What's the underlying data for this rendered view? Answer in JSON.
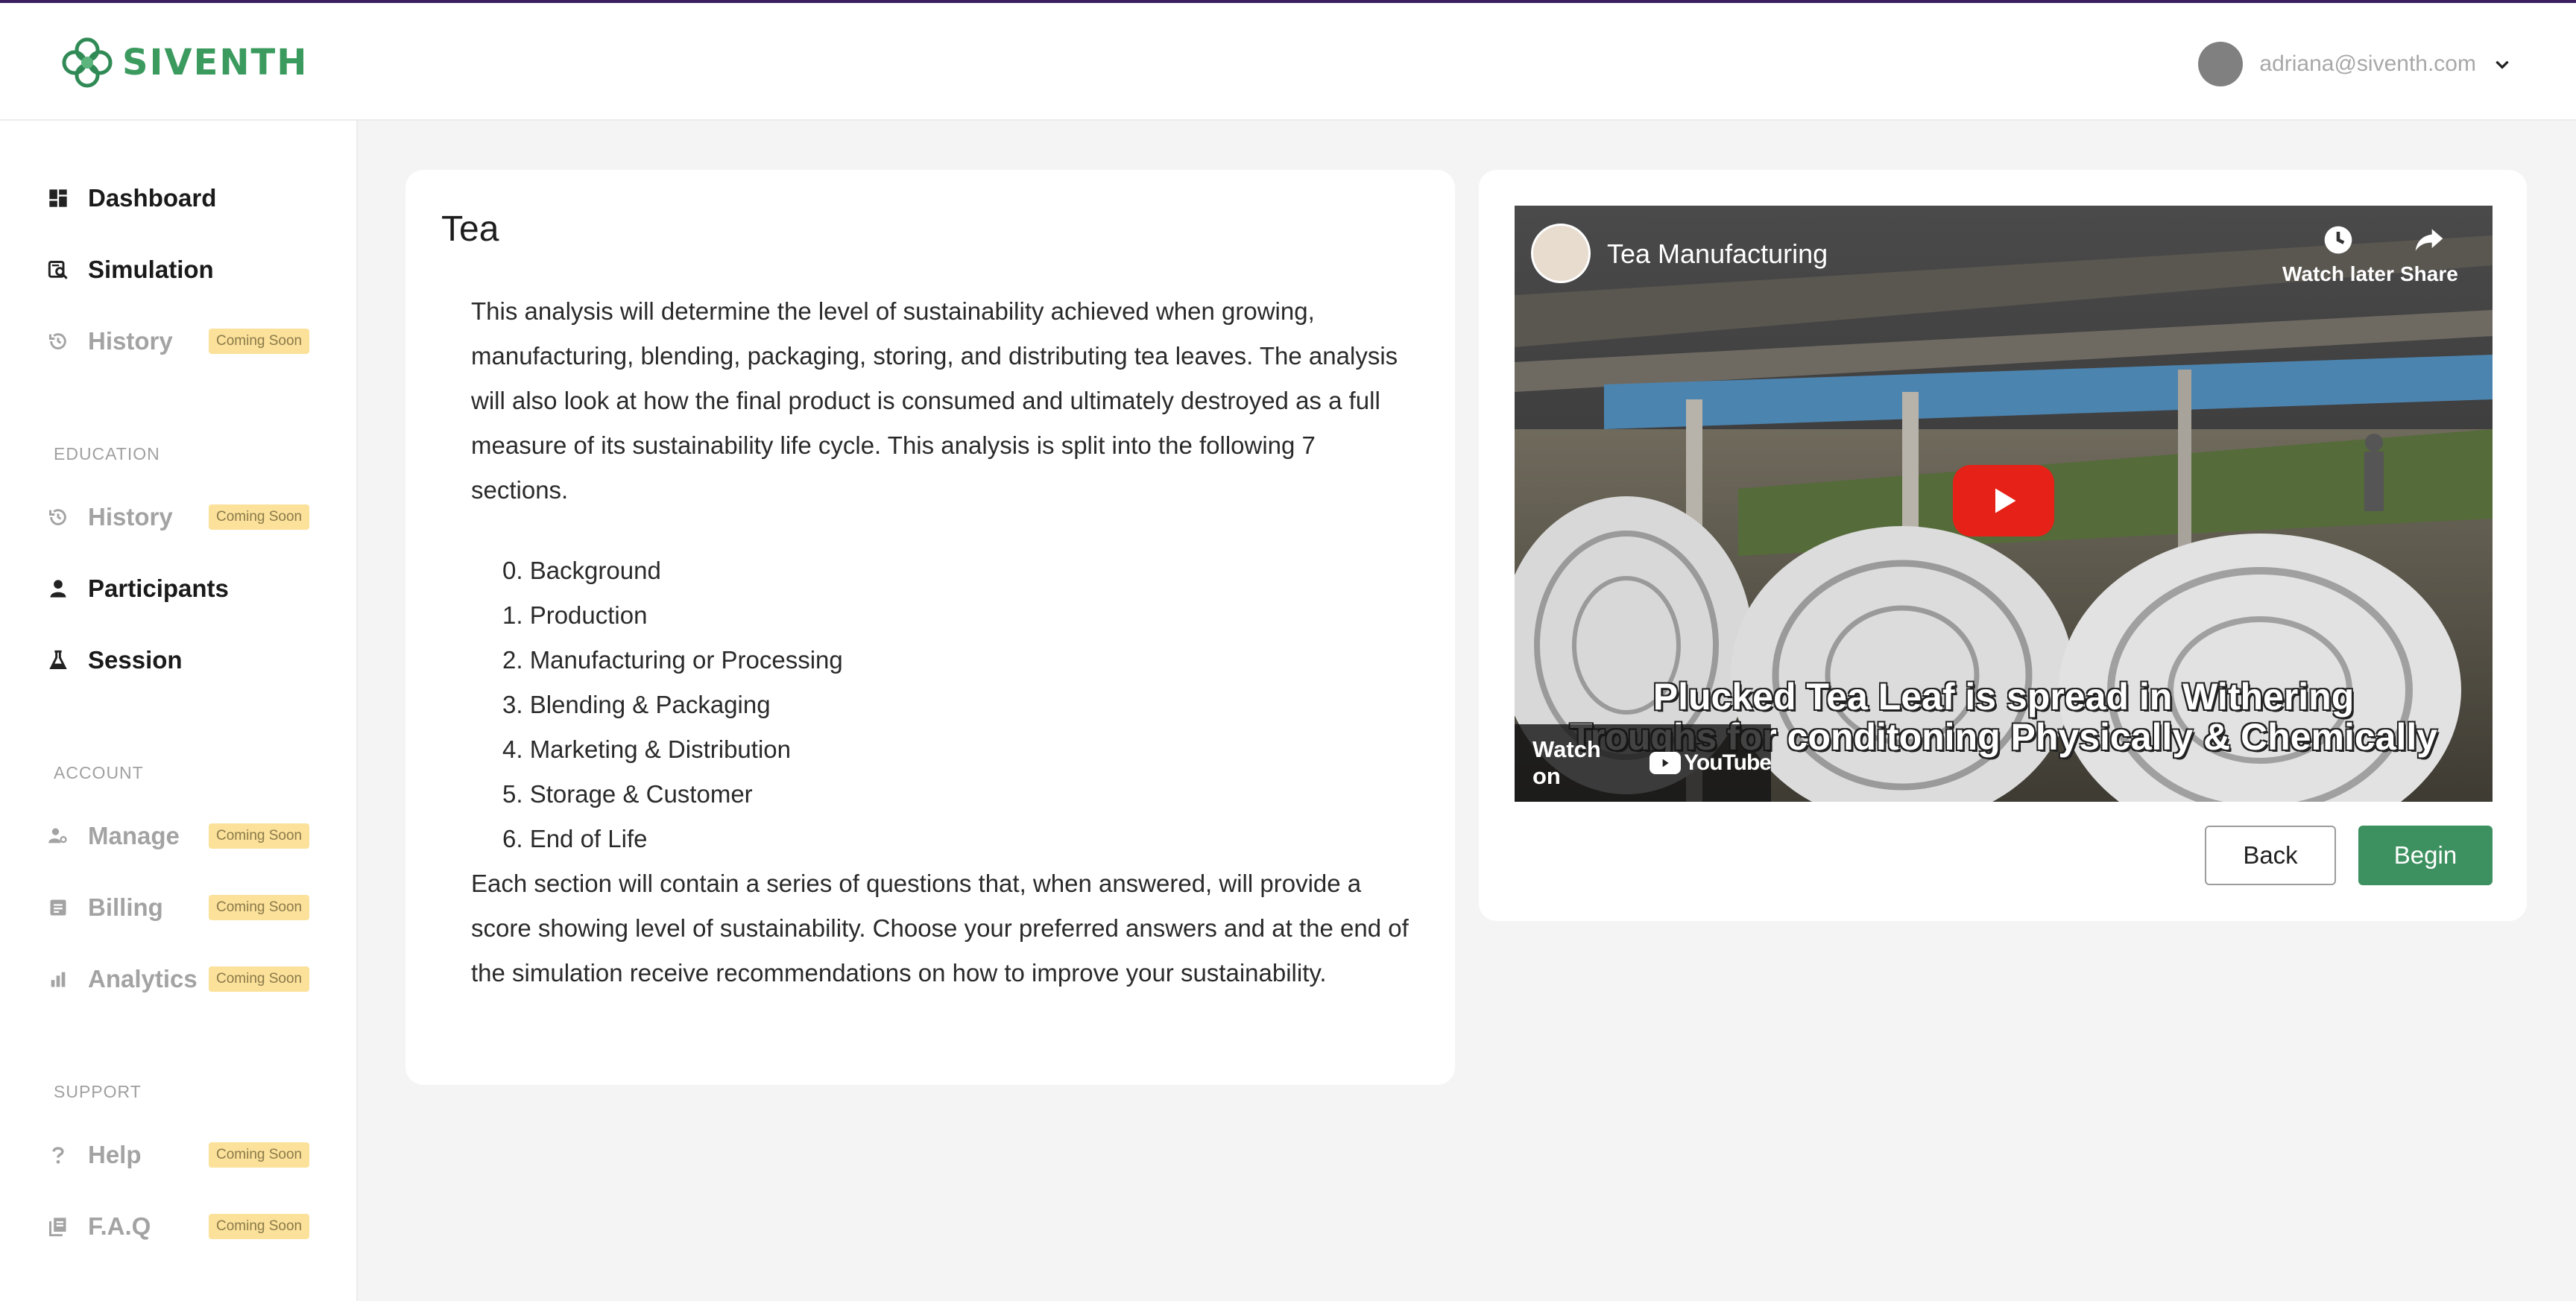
{
  "app": {
    "brand": "SIVENTH",
    "user_email": "adriana@siventh.com",
    "colors": {
      "brand_green": "#3b9a5e",
      "accent_bar": "#3b1f5e",
      "begin_button": "#3d9160",
      "badge_bg": "#fbe19a"
    }
  },
  "sidebar": {
    "main": [
      {
        "label": "Dashboard",
        "icon": "dashboard-icon",
        "coming_soon": false
      },
      {
        "label": "Simulation",
        "icon": "simulation-icon",
        "coming_soon": false
      },
      {
        "label": "History",
        "icon": "history-icon",
        "coming_soon": true
      }
    ],
    "education_title": "EDUCATION",
    "education": [
      {
        "label": "History",
        "icon": "history-icon",
        "coming_soon": true
      },
      {
        "label": "Participants",
        "icon": "person-icon",
        "coming_soon": false
      },
      {
        "label": "Session",
        "icon": "flask-icon",
        "coming_soon": false
      }
    ],
    "account_title": "ACCOUNT",
    "account": [
      {
        "label": "Manage",
        "icon": "manage-users-icon",
        "coming_soon": true
      },
      {
        "label": "Billing",
        "icon": "billing-icon",
        "coming_soon": true
      },
      {
        "label": "Analytics",
        "icon": "bar-chart-icon",
        "coming_soon": true
      }
    ],
    "support_title": "SUPPORT",
    "support": [
      {
        "label": "Help",
        "icon": "question-icon",
        "coming_soon": true
      },
      {
        "label": "F.A.Q",
        "icon": "faq-icon",
        "coming_soon": true
      }
    ],
    "badge_label": "Coming Soon"
  },
  "main": {
    "title": "Tea",
    "intro": "This analysis will determine the level of sustainability achieved when growing, manufacturing, blending, packaging, storing, and distributing tea leaves. The analysis will also look at how the final product is consumed and ultimately destroyed as a full measure of its sustainability life cycle. This analysis is split into the following 7 sections.",
    "sections": [
      "0. Background",
      "1. Production",
      "2. Manufacturing or Processing",
      "3. Blending & Packaging",
      "4. Marketing & Distribution",
      "5. Storage & Customer",
      "6. End of Life"
    ],
    "outro": "Each section will contain a series of questions that, when answered, will provide a score showing level of sustainability. Choose your preferred answers and at the end of the simulation receive recommendations on how to improve your sustainability."
  },
  "video": {
    "title": "Tea Manufacturing",
    "watch_later": "Watch later",
    "share": "Share",
    "caption_line1": "Plucked Tea Leaf is spread in Withering",
    "caption_line2": "Troughs for conditoning Physically & Chemically",
    "watch_on": "Watch on",
    "youtube": "YouTube"
  },
  "actions": {
    "back": "Back",
    "begin": "Begin"
  }
}
